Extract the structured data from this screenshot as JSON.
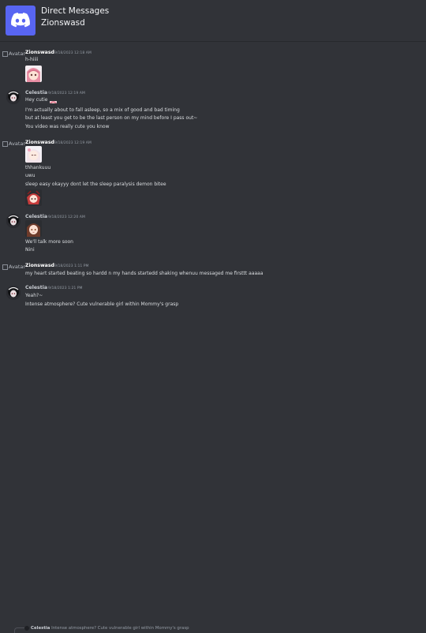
{
  "header": {
    "icon": "discord-logo-icon",
    "title": "Direct Messages",
    "subtitle": "Zionswasd"
  },
  "accent": "#5865f2",
  "avatar_alt": "Avatar",
  "messages": [
    {
      "author": "Zionswasd",
      "time": "9/18/2023 12:18 AM",
      "lines": [
        "h-hiiii"
      ],
      "sticker": "anime-sticker"
    },
    {
      "author": "Celestia",
      "time": "9/18/2023 12:19 AM",
      "lines": [
        "Hey cutie",
        "I'm actually about to fall asleep, so a mix of good and bad timing",
        "but at least you get to be the last person on my mind before I pass out~",
        "You video was really cute you know"
      ]
    },
    {
      "author": "Zionswasd",
      "time": "9/18/2023 12:19 AM",
      "lines": [
        "thhankuuu",
        "uwu",
        "sleep easy okayyy dont let the sleep paralysis demon bitee"
      ],
      "sticker": "anime-sticker"
    },
    {
      "author": "Celestia",
      "time": "9/18/2023 12:20 AM",
      "lines": [
        "We'll talk more soon",
        "Nini"
      ],
      "sticker": "anime-sticker"
    },
    {
      "author": "Zionswasd",
      "time": "9/18/2023 1:11 PM",
      "lines": [
        "my heart started beating so hardd n my hands startedd shaking whenuu messaged me firsttt aaaaa"
      ]
    },
    {
      "author": "Celestia",
      "time": "9/18/2023 1:21 PM",
      "lines": [
        "Yeah?~",
        "Intense atmosphere? Cute vulnerable girl within Mommy's grasp"
      ]
    }
  ],
  "reply_preview": {
    "author": "Celestia",
    "text": "Intense atmosphere? Cute vulnerable girl within Mommy's grasp"
  }
}
